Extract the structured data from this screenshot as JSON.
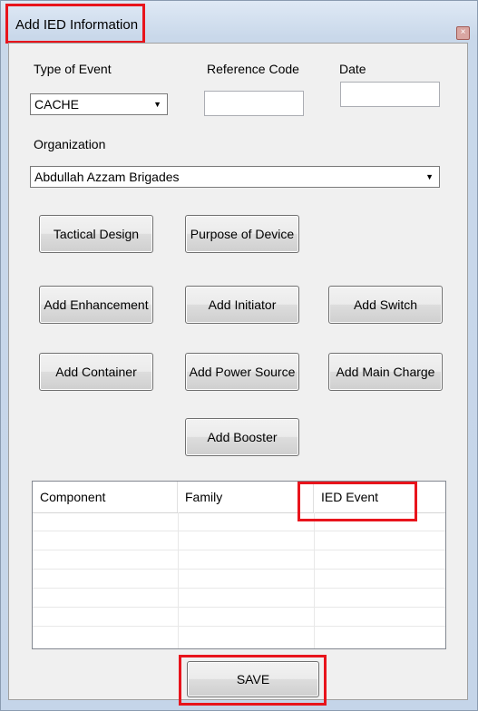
{
  "window": {
    "title": "Add IED Information",
    "close_glyph": "×"
  },
  "form": {
    "type_of_event_label": "Type of Event",
    "type_of_event_value": "CACHE",
    "reference_code_label": "Reference Code",
    "reference_code_value": "",
    "date_label": "Date",
    "date_value": "",
    "organization_label": "Organization",
    "organization_value": "Abdullah Azzam Brigades"
  },
  "buttons": {
    "tactical_design": "Tactical Design",
    "purpose_of_device": "Purpose of Device",
    "add_enhancement": "Add Enhancement",
    "add_initiator": "Add Initiator",
    "add_switch": "Add Switch",
    "add_container": "Add Container",
    "add_power_source": "Add Power Source",
    "add_main_charge": "Add Main Charge",
    "add_booster": "Add Booster",
    "save": "SAVE"
  },
  "grid": {
    "columns": [
      "Component",
      "Family",
      "IED Event"
    ]
  },
  "icons": {
    "dropdown": "chevron-down-icon",
    "close": "close-icon"
  },
  "colors": {
    "highlight": "#e8141c"
  }
}
